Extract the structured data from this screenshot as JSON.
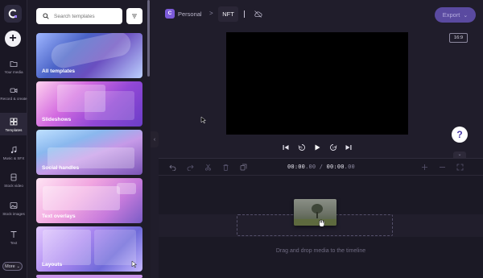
{
  "rail": {
    "items": [
      {
        "label": "Your media",
        "icon": "folder-icon"
      },
      {
        "label": "Record & create",
        "icon": "camera-icon"
      },
      {
        "label": "Templates",
        "icon": "templates-icon",
        "active": true
      },
      {
        "label": "Music & SFX",
        "icon": "music-note-icon"
      },
      {
        "label": "Stock video",
        "icon": "film-icon"
      },
      {
        "label": "Stock images",
        "icon": "image-icon"
      },
      {
        "label": "Text",
        "icon": "text-icon"
      }
    ],
    "more_label": "More"
  },
  "panel": {
    "search_placeholder": "Search templates",
    "cards": [
      {
        "title": "All templates"
      },
      {
        "title": "Slideshows"
      },
      {
        "title": "Social handles"
      },
      {
        "title": "Text overlays"
      },
      {
        "title": "Layouts"
      }
    ]
  },
  "topbar": {
    "workspace_initial": "C",
    "workspace_name": "Personal",
    "separator": ">",
    "project_title": "NFT",
    "export_label": "Export"
  },
  "preview": {
    "aspect_ratio": "16:9",
    "help_label": "?"
  },
  "timeline": {
    "timecode_current_main": "00:00",
    "timecode_current_frac": ".00",
    "timecode_sep": " / ",
    "timecode_total_main": "00:00",
    "timecode_total_frac": ".00",
    "drop_hint": "Drag and drop media to the timeline"
  },
  "colors": {
    "background": "#201d2b",
    "accent": "#5a4aa0",
    "workspace_chip": "#7c5bd9"
  }
}
